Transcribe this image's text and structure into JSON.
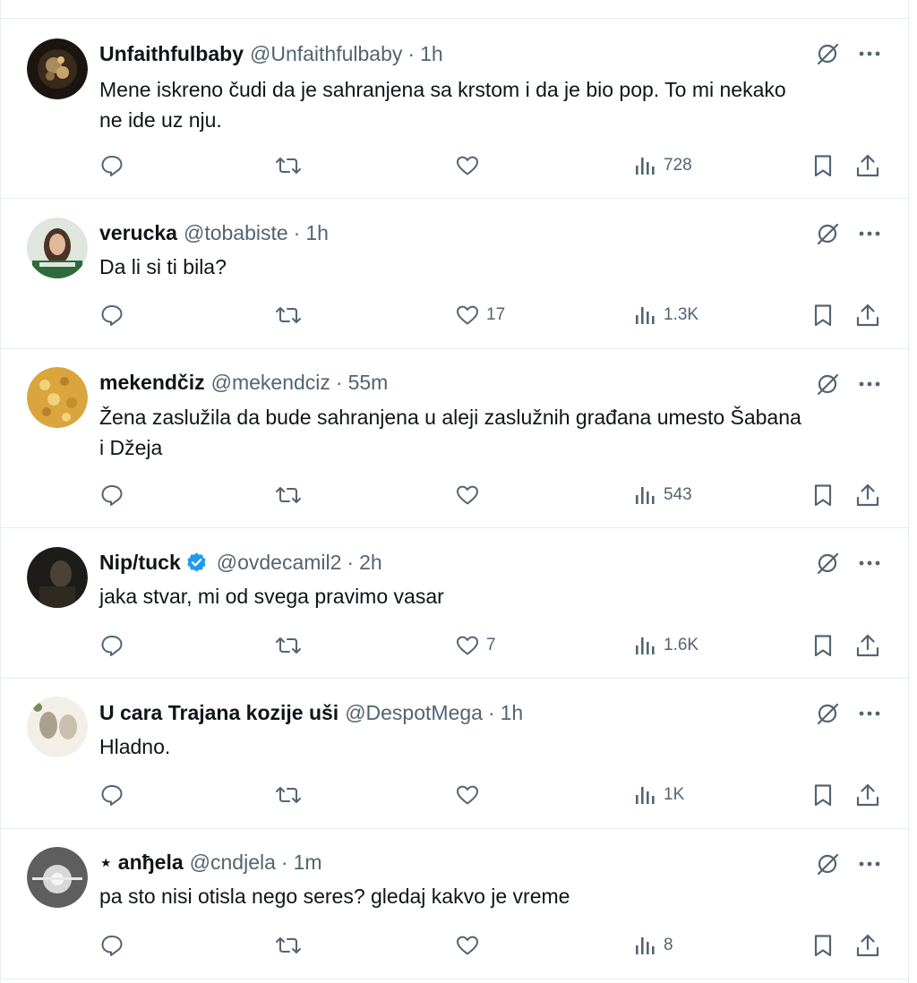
{
  "tweets": [
    {
      "name": "Unfaithfulbaby",
      "handle": "@Unfaithfulbaby",
      "time": "1h",
      "text_line1": "Mene iskreno čudi da je sahranjena sa krstom i da je bio pop. To mi nekako",
      "text_line2": "ne ide uz nju.",
      "likes": "",
      "views": "728",
      "avatar_colors": [
        "#1c1410",
        "#a88a5c"
      ]
    },
    {
      "name": "verucka",
      "handle": "@tobabiste",
      "time": "1h",
      "text_line1": "Da li si ti bila?",
      "likes": "17",
      "views": "1.3K",
      "avatar_colors": [
        "#dfe6dd",
        "#2c6b3a"
      ]
    },
    {
      "name": "mekendčiz",
      "handle": "@mekendciz",
      "time": "55m",
      "text_line1": "Žena zaslužila da bude sahranjena u aleji zaslužnih građana umesto Šabana",
      "text_line2": "i Džeja",
      "likes": "",
      "views": "543",
      "avatar_colors": [
        "#d9a53c",
        "#f0d27a"
      ]
    },
    {
      "name": "Nip/tuck",
      "handle": "@ovdecamil2",
      "time": "2h",
      "text_line1": "jaka stvar, mi od svega pravimo vasar",
      "likes": "7",
      "views": "1.6K",
      "avatar_colors": [
        "#1e1c18",
        "#4a4236"
      ]
    },
    {
      "name": "U cara Trajana kozije uši",
      "handle": "@DespotMega",
      "time": "1h",
      "text_line1": "Hladno.",
      "likes": "",
      "views": "1K",
      "avatar_colors": [
        "#f4efe6",
        "#a9a08f"
      ]
    },
    {
      "name": "⋆ anђela",
      "handle": "@cndjela",
      "time": "1m",
      "text_line1": "pa sto nisi otisla nego seres? gledaj kakvo je vreme",
      "likes": "",
      "views": "8",
      "avatar_colors": [
        "#f5f5f5",
        "#5e5e5e"
      ]
    }
  ],
  "colors": {
    "text": "#0f1419",
    "secondary": "#536471",
    "divider": "#e6ecf0",
    "verified": "#1d9bf0"
  }
}
